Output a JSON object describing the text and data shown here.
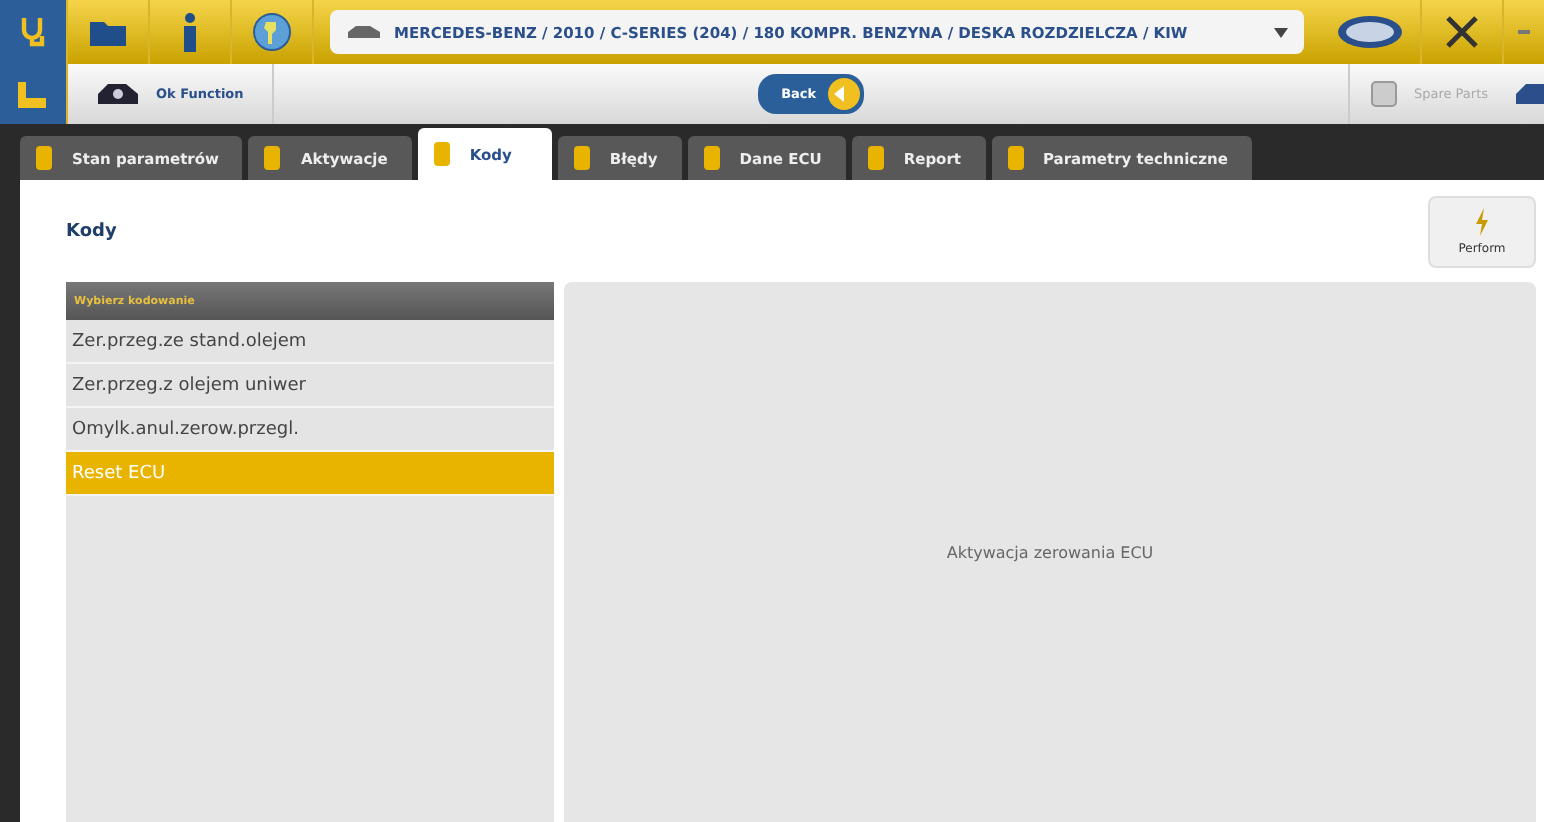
{
  "vehicle_path": "MERCEDES-BENZ / 2010 / C-SERIES (204) / 180 KOMPR. BENZYNA / DESKA ROZDZIELCZA / KIW",
  "toolbar": {
    "function_label": "Ok Function",
    "back_label": "Back",
    "spare_parts_label": "Spare Parts"
  },
  "tabs": [
    {
      "label": "Stan parametrów",
      "selected": false
    },
    {
      "label": "Aktywacje",
      "selected": false
    },
    {
      "label": "Kody",
      "selected": true
    },
    {
      "label": "Błędy",
      "selected": false
    },
    {
      "label": "Dane ECU",
      "selected": false
    },
    {
      "label": "Report",
      "selected": false
    },
    {
      "label": "Parametry techniczne",
      "selected": false
    }
  ],
  "page_title": "Kody",
  "perform_label": "Perform",
  "list": {
    "header": "Wybierz kodowanie",
    "items": [
      {
        "label": "Zer.przeg.ze stand.olejem",
        "selected": false
      },
      {
        "label": "Zer.przeg.z olejem uniwer",
        "selected": false
      },
      {
        "label": "Omylk.anul.zerow.przegl.",
        "selected": false
      },
      {
        "label": "Reset ECU",
        "selected": true
      }
    ]
  },
  "detail": "Aktywacja zerowania ECU"
}
